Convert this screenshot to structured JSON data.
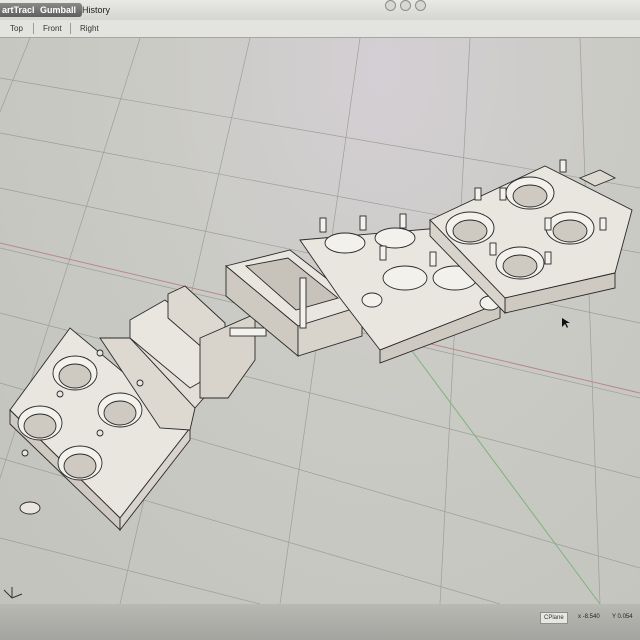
{
  "toolbar": {
    "smarttrack_label": "artTrack",
    "gumball_label": "Gumball",
    "history_label": "History"
  },
  "viewport_tabs": [
    "Top",
    "Front",
    "Right"
  ],
  "status": {
    "cplane_label": "CPlane",
    "x_label": "x -8.540",
    "y_label": "Y 0.054"
  },
  "colors": {
    "viewport_bg": "#c9c9c4",
    "model_face": "#e9e6df",
    "model_edge": "#2a2a2a",
    "axis_x": "#b58a8a",
    "axis_y": "#7fb27f"
  },
  "icons": {
    "axis_widget": "world-axes-icon",
    "cursor": "arrow-cursor-icon"
  }
}
